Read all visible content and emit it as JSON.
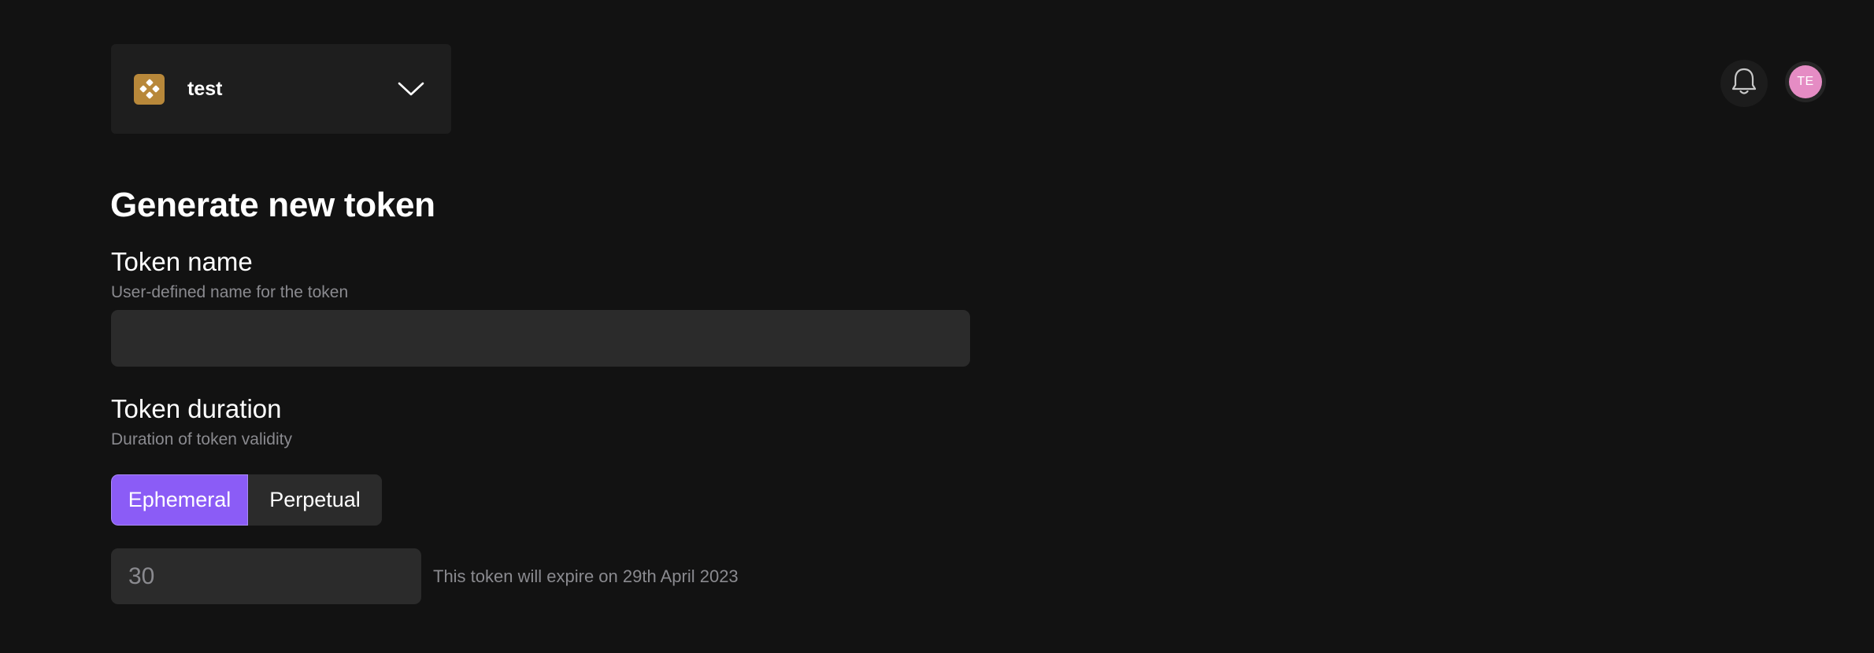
{
  "workspace": {
    "name": "test",
    "logo_icon": "workspace-logo-icon",
    "logo_color": "#b8883a",
    "dropdown_icon": "chevron-down-icon"
  },
  "header": {
    "notifications_icon": "bell-icon",
    "avatar_initials": "TE",
    "avatar_color": "#e58cc4"
  },
  "form": {
    "title": "Generate new token",
    "token_name": {
      "label": "Token name",
      "help": "User-defined name for the token",
      "value": ""
    },
    "token_duration": {
      "label": "Token duration",
      "help": "Duration of token validity",
      "options": [
        "Ephemeral",
        "Perpetual"
      ],
      "selected": "Ephemeral",
      "days_value": "30",
      "expiry_note": "This token will expire on 29th April 2023"
    }
  },
  "colors": {
    "background": "#121212",
    "accent": "#8b5cf6",
    "input_bg": "#2b2b2b",
    "muted_text": "#8a8a8f"
  }
}
